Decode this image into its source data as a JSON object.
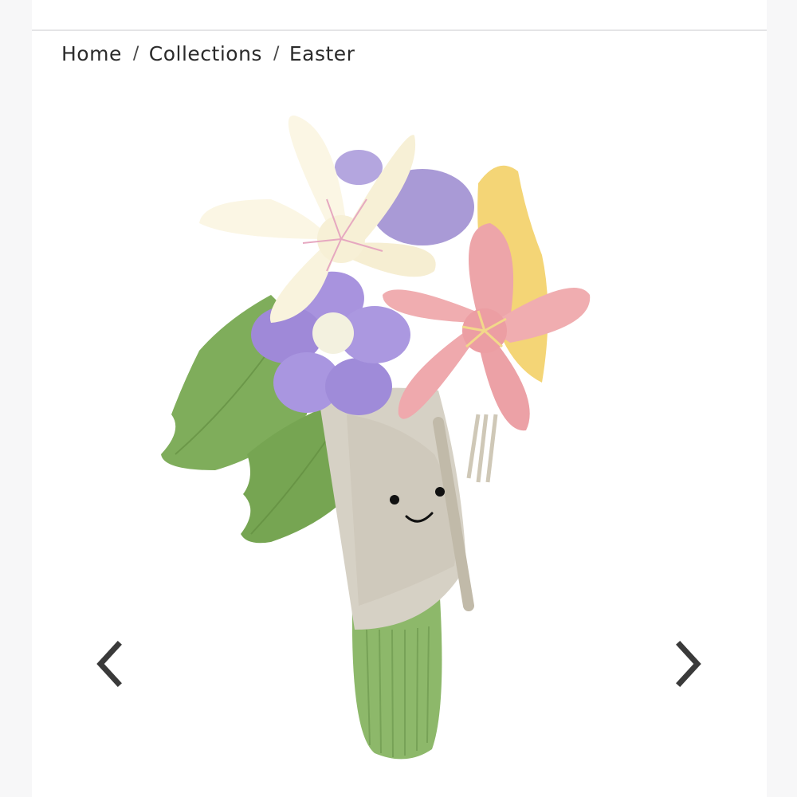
{
  "breadcrumb": {
    "items": [
      {
        "label": "Home"
      },
      {
        "label": "Collections"
      },
      {
        "label": "Easter"
      }
    ],
    "separator": "/"
  },
  "gallery": {
    "prev_icon": "chevron-left-icon",
    "next_icon": "chevron-right-icon"
  },
  "colors": {
    "arrow": "#3a3a3a",
    "divider": "#e4e4e6"
  }
}
